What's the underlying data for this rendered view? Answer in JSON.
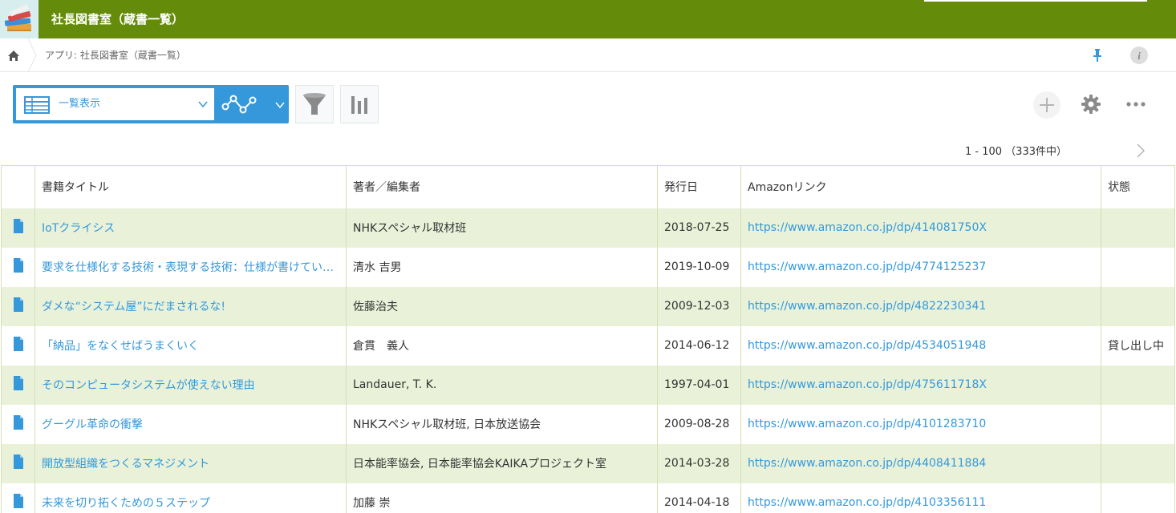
{
  "app": {
    "title": "社長図書室（蔵書一覧）",
    "icon": "books-icon",
    "header_color": "#648c0a"
  },
  "breadcrumb": {
    "home_icon": "home-icon",
    "text": "アプリ: 社長図書室（蔵書一覧）",
    "pin_icon": "pin-icon",
    "info_icon": "info-icon"
  },
  "toolbar": {
    "view_label": "一覧表示",
    "view_icon": "table-view-icon",
    "graph_icon": "graph-icon",
    "filter_icon": "filter-icon",
    "chart_icon": "bar-chart-icon",
    "add_icon": "plus-icon",
    "settings_icon": "gear-icon",
    "more_icon": "more-icon",
    "accent_color": "#3498db"
  },
  "pager": {
    "text": "1 - 100 （333件中）",
    "next_icon": "chevron-right-icon"
  },
  "table": {
    "columns": [
      "書籍タイトル",
      "著者／編集者",
      "発行日",
      "Amazonリンク",
      "状態"
    ],
    "row_icon": "document-icon",
    "row_stripe_color": "#e9f2d9",
    "rows": [
      {
        "title": "IoTクライシス",
        "author": "NHKスペシャル取材班",
        "date": "2018-07-25",
        "link": "https://www.amazon.co.jp/dp/414081750X",
        "status": ""
      },
      {
        "title": "要求を仕様化する技術・表現する技術：仕様が書けてい…",
        "author": "清水 吉男",
        "date": "2019-10-09",
        "link": "https://www.amazon.co.jp/dp/4774125237",
        "status": ""
      },
      {
        "title": "ダメな“システム屋”にだまされるな!",
        "author": "佐藤治夫",
        "date": "2009-12-03",
        "link": "https://www.amazon.co.jp/dp/4822230341",
        "status": ""
      },
      {
        "title": "「納品」をなくせばうまくいく",
        "author": "倉貫　義人",
        "date": "2014-06-12",
        "link": "https://www.amazon.co.jp/dp/4534051948",
        "status": "貸し出し中"
      },
      {
        "title": "そのコンピュータシステムが使えない理由",
        "author": "Landauer, T. K.",
        "date": "1997-04-01",
        "link": "https://www.amazon.co.jp/dp/475611718X",
        "status": ""
      },
      {
        "title": "グーグル革命の衝撃",
        "author": "NHKスペシャル取材班, 日本放送協会",
        "date": "2009-08-28",
        "link": "https://www.amazon.co.jp/dp/4101283710",
        "status": ""
      },
      {
        "title": "開放型組織をつくるマネジメント",
        "author": "日本能率協会, 日本能率協会KAIKAプロジェクト室",
        "date": "2014-03-28",
        "link": "https://www.amazon.co.jp/dp/4408411884",
        "status": ""
      },
      {
        "title": "未来を切り拓くための５ステップ",
        "author": "加藤 崇",
        "date": "2014-04-18",
        "link": "https://www.amazon.co.jp/dp/4103356111",
        "status": ""
      }
    ]
  }
}
